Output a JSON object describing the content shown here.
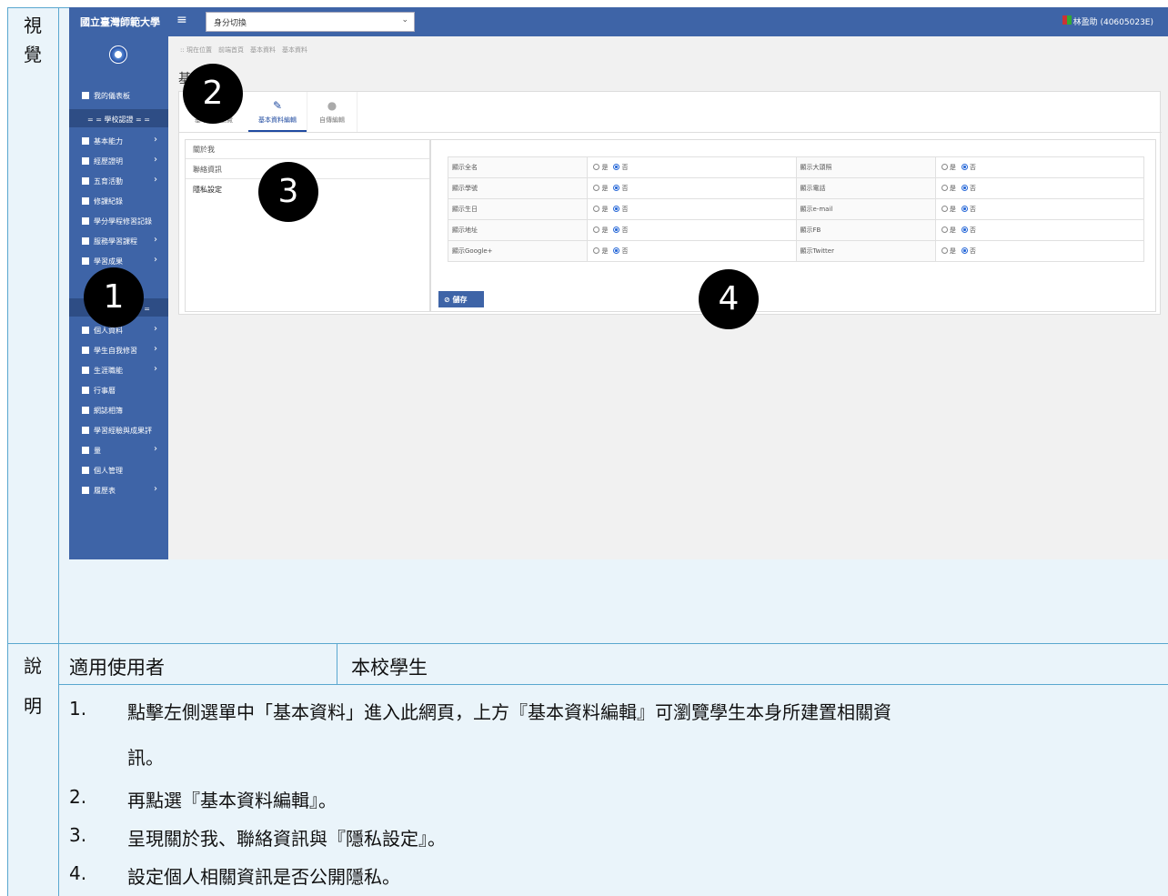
{
  "doc": {
    "side_top": "視覺",
    "side_bottom_1": "說",
    "side_bottom_2": "明",
    "user_label": "適用使用者",
    "user_value": "本校學生",
    "steps": [
      {
        "num": "1.",
        "text": "點擊左側選單中「基本資料」進入此網頁，上方『基本資料編輯』可瀏覽學生本身所建置相關資",
        "cont": "訊。"
      },
      {
        "num": "2.",
        "text": "再點選『基本資料編輯』。"
      },
      {
        "num": "3.",
        "text": "呈現關於我、聯絡資訊與『隱私設定』。"
      },
      {
        "num": "4.",
        "text": "設定個人相關資訊是否公開隱私。"
      }
    ]
  },
  "screenshot": {
    "brand": "國立臺灣師範大學",
    "hamburger": "≡",
    "identity_select": "身分切換",
    "user": "林盈助 (40605023E)",
    "breadcrumb": ":: 現在位置　前端首頁　基本資料　基本資料",
    "page_title_fragment": "基",
    "sidebar": {
      "dashboard": "我的儀表板",
      "section_school": "= = 學校認證 = =",
      "items": [
        {
          "label": "基本能力",
          "chevron": true
        },
        {
          "label": "經歷證明",
          "chevron": true
        },
        {
          "label": "五育活動",
          "chevron": true
        },
        {
          "label": "修課紀錄",
          "chevron": false
        },
        {
          "label": "學分學程修習記錄",
          "chevron": false
        },
        {
          "label": "服務學習課程",
          "chevron": true
        },
        {
          "label": "學習成果",
          "chevron": true
        }
      ],
      "section_personal": "= = 個人建置 = =",
      "items2": [
        {
          "label": "個人資料",
          "chevron": true
        },
        {
          "label": "學生自我修習",
          "chevron": true
        },
        {
          "label": "生涯職能",
          "chevron": true
        },
        {
          "label": "行事曆",
          "chevron": false
        },
        {
          "label": "網誌相簿",
          "chevron": false
        },
        {
          "label": "學習經驗與成果評",
          "chevron": false
        },
        {
          "label": "量",
          "chevron": true
        },
        {
          "label": "個人管理",
          "chevron": false
        },
        {
          "label": "履歷表",
          "chevron": true
        }
      ]
    },
    "tabs": [
      {
        "label": "基本資料瀏覽",
        "icon": "eye-icon"
      },
      {
        "label": "基本資料編輯",
        "icon": "edit-icon"
      },
      {
        "label": "自傳編輯",
        "icon": "user-icon"
      }
    ],
    "subnav": [
      "關於我",
      "聯絡資訊",
      "隱私設定"
    ],
    "privacy": {
      "yes": "是",
      "no": "否",
      "rows": [
        {
          "l1": "顯示全名",
          "l2": "顯示大頭照"
        },
        {
          "l1": "顯示學號",
          "l2": "顯示電話"
        },
        {
          "l1": "顯示生日",
          "l2": "顯示e-mail"
        },
        {
          "l1": "顯示地址",
          "l2": "顯示FB"
        },
        {
          "l1": "顯示Google+",
          "l2": "顯示Twitter"
        }
      ],
      "save": "儲存"
    },
    "markers": [
      "2",
      "3",
      "1",
      "4"
    ]
  }
}
